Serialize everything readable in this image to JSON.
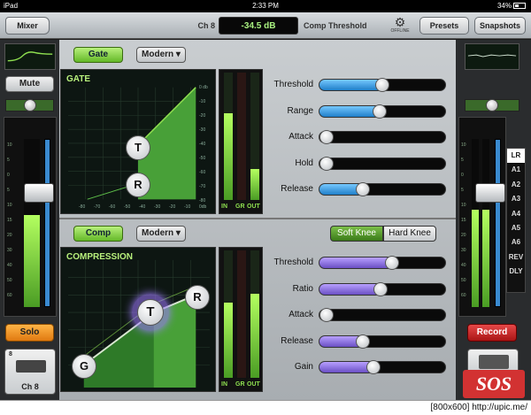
{
  "status_bar": {
    "device": "iPad",
    "time": "2:33 PM",
    "battery": "34%"
  },
  "header": {
    "mixer_label": "Mixer",
    "channel": "Ch 8",
    "param_value": "-34.5 dB",
    "param_name": "Comp Threshold",
    "offline_label": "OFFLINE",
    "presets_label": "Presets",
    "snapshots_label": "Snapshots"
  },
  "left_strip": {
    "mute_label": "Mute",
    "solo_label": "Solo",
    "channel_label": "Ch 8",
    "channel_number": "8",
    "meter_level": 0.55,
    "fader_level": 0.68
  },
  "right_strip": {
    "record_label": "Record",
    "buses": [
      "LR",
      "A1",
      "A2",
      "A3",
      "A4",
      "A5",
      "A6",
      "REV",
      "DLY"
    ],
    "selected_bus": "LR",
    "fader_level": 0.68
  },
  "gate": {
    "toggle_label": "Gate",
    "mode_label": "Modern",
    "graph_title": "GATE",
    "y_ticks": [
      "0 db",
      "-10",
      "-20",
      "-30",
      "-40",
      "-50",
      "-60",
      "-70",
      "-80"
    ],
    "x_ticks": [
      "-80",
      "-70",
      "-60",
      "-50",
      "-40",
      "-30",
      "-20",
      "-10",
      "0db"
    ],
    "meter_labels": [
      "IN",
      "GR",
      "OUT"
    ],
    "meter_levels": [
      0.68,
      0.0,
      0.24
    ],
    "threshold_node": "T",
    "range_node": "R",
    "params": [
      {
        "label": "Threshold",
        "value": 0.45
      },
      {
        "label": "Range",
        "value": 0.43
      },
      {
        "label": "Attack",
        "value": 0.0
      },
      {
        "label": "Hold",
        "value": 0.0
      },
      {
        "label": "Release",
        "value": 0.3
      }
    ]
  },
  "comp": {
    "toggle_label": "Comp",
    "mode_label": "Modern",
    "graph_title": "COMPRESSION",
    "soft_knee_label": "Soft Knee",
    "hard_knee_label": "Hard Knee",
    "meter_labels": [
      "IN",
      "GR",
      "OUT"
    ],
    "meter_levels": [
      0.59,
      0.0,
      0.66
    ],
    "gain_node": "G",
    "threshold_node": "T",
    "ratio_node": "R",
    "params": [
      {
        "label": "Threshold",
        "value": 0.53
      },
      {
        "label": "Ratio",
        "value": 0.44
      },
      {
        "label": "Attack",
        "value": 0.0
      },
      {
        "label": "Release",
        "value": 0.3
      },
      {
        "label": "Gain",
        "value": 0.38
      }
    ]
  },
  "fader_scale": [
    "10",
    "5",
    "0",
    "5",
    "10",
    "15",
    "20",
    "30",
    "40",
    "50",
    "60"
  ],
  "logo": {
    "text": "SOS"
  },
  "footer": {
    "text": "[800x600] http://upic.me/"
  },
  "colors": {
    "accent_green": "#8fe050",
    "slider_blue": "#2a90e0",
    "slider_purple": "#8a6ee0",
    "solo_orange": "#f59a2a",
    "record_red": "#cc2a2a"
  }
}
